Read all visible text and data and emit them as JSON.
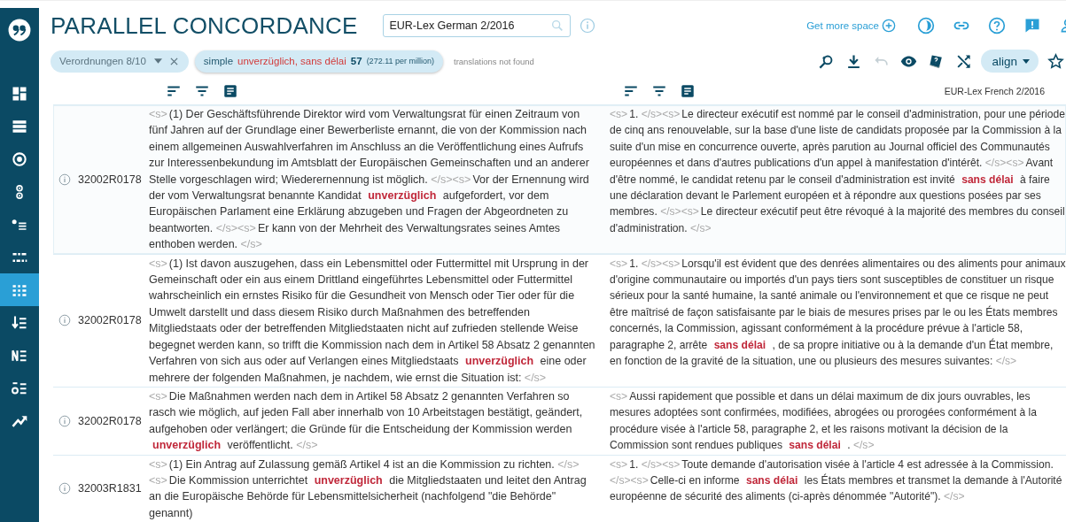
{
  "sidebar": {
    "items": [
      {
        "selected": false
      },
      {
        "selected": false
      },
      {
        "selected": false
      },
      {
        "selected": false
      },
      {
        "selected": false
      },
      {
        "selected": false
      },
      {
        "selected": true
      },
      {
        "selected": false
      },
      {
        "selected": false
      },
      {
        "selected": false
      },
      {
        "selected": false
      }
    ]
  },
  "header": {
    "title": "PARALLEL CONCORDANCE",
    "search": {
      "value": "EUR-Lex German 2/2016"
    },
    "get_more_space": "Get more space"
  },
  "filters": {
    "corpus_chip": {
      "label": "Verordnungen 8/10"
    },
    "query_chip": {
      "mode": "simple",
      "terms": "unverzüglich, sans délai",
      "count": "57",
      "frequency": "(272.11 per million)"
    },
    "note": "translations not found"
  },
  "toolbar": [
    {
      "disabled": false
    },
    {
      "disabled": false
    },
    {
      "disabled": true
    },
    {
      "disabled": false
    },
    {
      "disabled": false
    },
    {
      "disabled": false
    }
  ],
  "align_button": {
    "label": "align"
  },
  "columns": [
    {},
    {
      "corpus": "EUR-Lex French 2/2016"
    }
  ],
  "rows": [
    {
      "id": "32002R0178",
      "source": [
        {
          "kind": "tag",
          "text": "<s>"
        },
        {
          "kind": "text",
          "text": "(1) Der Geschäftsführende Direktor wird vom Verwaltungsrat für einen Zeitraum von fünf Jahren auf der Grundlage einer Bewerberliste ernannt, die von der Kommission nach einem allgemeinen Auswahlverfahren im Anschluss an die Veröffentlichung eines Aufrufs zur Interessenbekundung im Amtsblatt der Europäischen Gemeinschaften und an anderer Stelle vorgeschlagen wird; Wiederernennung ist möglich. "
        },
        {
          "kind": "tag",
          "text": "</s><s>"
        },
        {
          "kind": "text",
          "text": "Vor der Ernennung wird der vom Verwaltungsrat benannte Kandidat "
        },
        {
          "kind": "hit",
          "text": "unverzüglich"
        },
        {
          "kind": "text",
          "text": " aufgefordert, vor dem Europäischen Parlament eine Erklärung abzugeben und Fragen der Abgeordneten zu beantworten. "
        },
        {
          "kind": "tag",
          "text": "</s><s>"
        },
        {
          "kind": "text",
          "text": "Er kann von der Mehrheit des Verwaltungsrates seines Amtes enthoben werden. "
        },
        {
          "kind": "tag",
          "text": "</s>"
        }
      ],
      "target": [
        {
          "kind": "tag",
          "text": "<s>"
        },
        {
          "kind": "text",
          "text": "1. "
        },
        {
          "kind": "tag",
          "text": "</s><s>"
        },
        {
          "kind": "text",
          "text": "Le directeur exécutif est nommé par le conseil d'administration, pour une période de cinq ans renouvelable, sur la base d'une liste de candidats proposée par la Commission à la suite d'un mise en concurrence ouverte, après parution au Journal officiel des Communautés européennes et dans d'autres publications d'un appel à manifestation d'intérêt. "
        },
        {
          "kind": "tag",
          "text": "</s><s>"
        },
        {
          "kind": "text",
          "text": "Avant d'être nommé, le candidat retenu par le conseil d'administration est invité "
        },
        {
          "kind": "hit",
          "text": "sans délai"
        },
        {
          "kind": "text",
          "text": " à faire une déclaration devant le Parlement européen et à répondre aux questions posées par ses membres. "
        },
        {
          "kind": "tag",
          "text": "</s><s>"
        },
        {
          "kind": "text",
          "text": "Le directeur exécutif peut être révoqué à la majorité des membres du conseil d'administration. "
        },
        {
          "kind": "tag",
          "text": "</s>"
        }
      ]
    },
    {
      "id": "32002R0178",
      "source": [
        {
          "kind": "tag",
          "text": "<s>"
        },
        {
          "kind": "text",
          "text": "(1) Ist davon auszugehen, dass ein Lebensmittel oder Futtermittel mit Ursprung in der Gemeinschaft oder ein aus einem Drittland eingeführtes Lebensmittel oder Futtermittel wahrscheinlich ein ernstes Risiko für die Gesundheit von Mensch oder Tier oder für die Umwelt darstellt und dass diesem Risiko durch Maßnahmen des betreffenden Mitgliedstaats oder der betreffenden Mitgliedstaaten nicht auf zufrieden stellende Weise begegnet werden kann, so trifft die Kommission nach dem in Artikel 58 Absatz 2 genannten Verfahren von sich aus oder auf Verlangen eines Mitgliedstaats "
        },
        {
          "kind": "hit",
          "text": "unverzüglich"
        },
        {
          "kind": "text",
          "text": " eine oder mehrere der folgenden Maßnahmen, je nachdem, wie ernst die Situation ist: "
        },
        {
          "kind": "tag",
          "text": "</s>"
        }
      ],
      "target": [
        {
          "kind": "tag",
          "text": "<s>"
        },
        {
          "kind": "text",
          "text": "1. "
        },
        {
          "kind": "tag",
          "text": "</s><s>"
        },
        {
          "kind": "text",
          "text": "Lorsqu'il est évident que des denrées alimentaires ou des aliments pour animaux d'origine communautaire ou importés d'un pays tiers sont susceptibles de constituer un risque sérieux pour la santé humaine, la santé animale ou l'environnement et que ce risque ne peut être maîtrisé de façon satisfaisante par le biais de mesures prises par le ou les États membres concernés, la Commission, agissant conformément à la procédure prévue à l'article 58, paragraphe 2, arrête "
        },
        {
          "kind": "hit",
          "text": "sans délai"
        },
        {
          "kind": "text",
          "text": " , de sa propre initiative ou à la demande d'un État membre, en fonction de la gravité de la situation, une ou plusieurs des mesures suivantes: "
        },
        {
          "kind": "tag",
          "text": "</s>"
        }
      ]
    },
    {
      "id": "32002R0178",
      "source": [
        {
          "kind": "tag",
          "text": "<s>"
        },
        {
          "kind": "text",
          "text": "Die Maßnahmen werden nach dem in Artikel 58 Absatz 2 genannten Verfahren so rasch wie möglich, auf jeden Fall aber innerhalb von 10 Arbeitstagen bestätigt, geändert, aufgehoben oder verlängert; die Gründe für die Entscheidung der Kommission werden "
        },
        {
          "kind": "hit",
          "text": "unverzüglich"
        },
        {
          "kind": "text",
          "text": " veröffentlicht. "
        },
        {
          "kind": "tag",
          "text": "</s>"
        }
      ],
      "target": [
        {
          "kind": "tag",
          "text": "<s>"
        },
        {
          "kind": "text",
          "text": "Aussi rapidement que possible et dans un délai maximum de dix jours ouvrables, les mesures adoptées sont confirmées, modifiées, abrogées ou prorogées conformément à la procédure visée à l'article 58, paragraphe 2, et les raisons motivant la décision de la Commission sont rendues publiques "
        },
        {
          "kind": "hit",
          "text": "sans délai"
        },
        {
          "kind": "text",
          "text": " . "
        },
        {
          "kind": "tag",
          "text": "</s>"
        }
      ]
    },
    {
      "id": "32003R1831",
      "source": [
        {
          "kind": "tag",
          "text": "<s>"
        },
        {
          "kind": "text",
          "text": "(1) Ein Antrag auf Zulassung gemäß Artikel 4 ist an die Kommission zu richten. "
        },
        {
          "kind": "tag",
          "text": "</s><s>"
        },
        {
          "kind": "text",
          "text": "Die Kommission unterrichtet "
        },
        {
          "kind": "hit",
          "text": "unverzüglich"
        },
        {
          "kind": "text",
          "text": " die Mitgliedstaaten und leitet den Antrag an die Europäische Behörde für Lebensmittelsicherheit (nachfolgend \"die Behörde\" genannt)"
        }
      ],
      "target": [
        {
          "kind": "tag",
          "text": "<s>"
        },
        {
          "kind": "text",
          "text": "1. "
        },
        {
          "kind": "tag",
          "text": "</s><s>"
        },
        {
          "kind": "text",
          "text": "Toute demande d'autorisation visée à l'article 4 est adressée à la Commission. "
        },
        {
          "kind": "tag",
          "text": "</s><s>"
        },
        {
          "kind": "text",
          "text": "Celle-ci en informe "
        },
        {
          "kind": "hit",
          "text": "sans délai"
        },
        {
          "kind": "text",
          "text": " les États membres et transmet la demande à l'Autorité européenne de sécurité des aliments (ci-après dénommée \"Autorité\"). "
        },
        {
          "kind": "tag",
          "text": "</s>"
        }
      ]
    }
  ]
}
